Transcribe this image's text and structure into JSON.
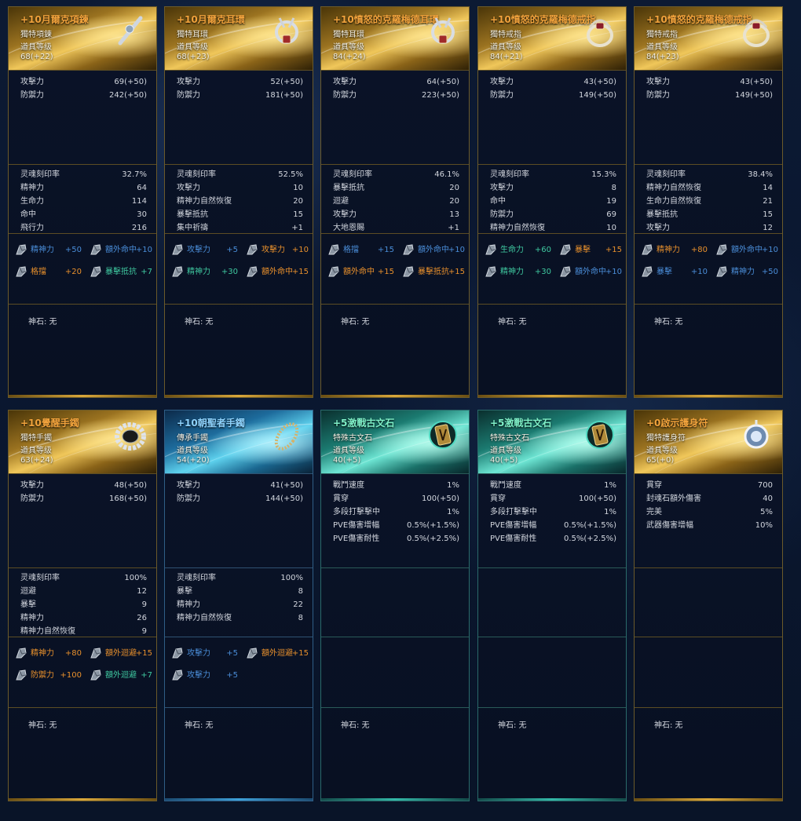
{
  "god_stone_label": "神石: 无",
  "cards": [
    {
      "theme": "gold",
      "title": "+10月爾克項鍊",
      "type": "獨特項鍊",
      "level_label": "道具等级",
      "level": "68(+22)",
      "icon": "necklace-icon",
      "base": [
        {
          "k": "攻擊力",
          "v": "69(+50)"
        },
        {
          "k": "防禦力",
          "v": "242(+50)"
        }
      ],
      "soul": [
        {
          "k": "灵魂刻印率",
          "v": "32.7%"
        },
        {
          "k": "精神力",
          "v": "64"
        },
        {
          "k": "生命力",
          "v": "114"
        },
        {
          "k": "命中",
          "v": "30"
        },
        {
          "k": "飛行力",
          "v": "216"
        }
      ],
      "stones": [
        {
          "name": "精神力",
          "val": "+50",
          "color": "blue"
        },
        {
          "name": "額外命中",
          "val": "+10",
          "color": "blue"
        },
        {
          "name": "格擋",
          "val": "+20",
          "color": "orange"
        },
        {
          "name": "暴擊抵抗",
          "val": "+7",
          "color": "green"
        }
      ]
    },
    {
      "theme": "gold",
      "title": "+10月爾克耳環",
      "type": "獨特耳環",
      "level_label": "道具等级",
      "level": "68(+23)",
      "icon": "earring-icon",
      "base": [
        {
          "k": "攻擊力",
          "v": "52(+50)"
        },
        {
          "k": "防禦力",
          "v": "181(+50)"
        }
      ],
      "soul": [
        {
          "k": "灵魂刻印率",
          "v": "52.5%"
        },
        {
          "k": "攻擊力",
          "v": "10"
        },
        {
          "k": "精神力自然恢復",
          "v": "20"
        },
        {
          "k": "暴擊抵抗",
          "v": "15"
        },
        {
          "k": "集中祈禱",
          "v": "+1"
        }
      ],
      "stones": [
        {
          "name": "攻擊力",
          "val": "+5",
          "color": "blue"
        },
        {
          "name": "攻擊力",
          "val": "+10",
          "color": "orange"
        },
        {
          "name": "精神力",
          "val": "+30",
          "color": "green"
        },
        {
          "name": "額外命中",
          "val": "+15",
          "color": "orange"
        }
      ]
    },
    {
      "theme": "gold",
      "title": "+10憤怒的克羅梅德耳環",
      "type": "獨特耳環",
      "level_label": "道具等级",
      "level": "84(+24)",
      "icon": "earring-icon",
      "base": [
        {
          "k": "攻擊力",
          "v": "64(+50)"
        },
        {
          "k": "防禦力",
          "v": "223(+50)"
        }
      ],
      "soul": [
        {
          "k": "灵魂刻印率",
          "v": "46.1%"
        },
        {
          "k": "暴擊抵抗",
          "v": "20"
        },
        {
          "k": "迴避",
          "v": "20"
        },
        {
          "k": "攻擊力",
          "v": "13"
        },
        {
          "k": "大地恩賜",
          "v": "+1"
        }
      ],
      "stones": [
        {
          "name": "格擋",
          "val": "+15",
          "color": "blue"
        },
        {
          "name": "額外命中",
          "val": "+10",
          "color": "blue"
        },
        {
          "name": "額外命中",
          "val": "+15",
          "color": "orange"
        },
        {
          "name": "暴擊抵抗",
          "val": "+15",
          "color": "orange"
        }
      ]
    },
    {
      "theme": "gold",
      "title": "+10憤怒的克羅梅德戒指",
      "type": "獨特戒指",
      "level_label": "道具等级",
      "level": "84(+21)",
      "icon": "ring-icon",
      "base": [
        {
          "k": "攻擊力",
          "v": "43(+50)"
        },
        {
          "k": "防禦力",
          "v": "149(+50)"
        }
      ],
      "soul": [
        {
          "k": "灵魂刻印率",
          "v": "15.3%"
        },
        {
          "k": "攻擊力",
          "v": "8"
        },
        {
          "k": "命中",
          "v": "19"
        },
        {
          "k": "防禦力",
          "v": "69"
        },
        {
          "k": "精神力自然恢復",
          "v": "10"
        }
      ],
      "stones": [
        {
          "name": "生命力",
          "val": "+60",
          "color": "green"
        },
        {
          "name": "暴擊",
          "val": "+15",
          "color": "orange"
        },
        {
          "name": "精神力",
          "val": "+30",
          "color": "green"
        },
        {
          "name": "額外命中",
          "val": "+10",
          "color": "blue"
        }
      ]
    },
    {
      "theme": "gold",
      "title": "+10憤怒的克羅梅德戒指",
      "type": "獨特戒指",
      "level_label": "道具等级",
      "level": "84(+23)",
      "icon": "ring-icon",
      "base": [
        {
          "k": "攻擊力",
          "v": "43(+50)"
        },
        {
          "k": "防禦力",
          "v": "149(+50)"
        }
      ],
      "soul": [
        {
          "k": "灵魂刻印率",
          "v": "38.4%"
        },
        {
          "k": "精神力自然恢復",
          "v": "14"
        },
        {
          "k": "生命力自然恢復",
          "v": "21"
        },
        {
          "k": "暴擊抵抗",
          "v": "15"
        },
        {
          "k": "攻擊力",
          "v": "12"
        }
      ],
      "stones": [
        {
          "name": "精神力",
          "val": "+80",
          "color": "orange"
        },
        {
          "name": "額外命中",
          "val": "+10",
          "color": "blue"
        },
        {
          "name": "暴擊",
          "val": "+10",
          "color": "blue"
        },
        {
          "name": "精神力",
          "val": "+50",
          "color": "blue"
        }
      ]
    },
    {
      "theme": "gold",
      "title": "+10覺醒手鐲",
      "type": "獨特手鐲",
      "level_label": "道具等级",
      "level": "63(+24)",
      "icon": "bracelet-icon",
      "base": [
        {
          "k": "攻擊力",
          "v": "48(+50)"
        },
        {
          "k": "防禦力",
          "v": "168(+50)"
        }
      ],
      "soul": [
        {
          "k": "灵魂刻印率",
          "v": "100%"
        },
        {
          "k": "迴避",
          "v": "12"
        },
        {
          "k": "暴擊",
          "v": "9"
        },
        {
          "k": "精神力",
          "v": "26"
        },
        {
          "k": "精神力自然恢復",
          "v": "9"
        }
      ],
      "stones": [
        {
          "name": "精神力",
          "val": "+80",
          "color": "orange"
        },
        {
          "name": "額外迴避",
          "val": "+15",
          "color": "orange"
        },
        {
          "name": "防禦力",
          "val": "+100",
          "color": "orange"
        },
        {
          "name": "額外迴避",
          "val": "+7",
          "color": "green"
        }
      ]
    },
    {
      "theme": "blue",
      "title": "+10朝聖者手鐲",
      "type": "傳承手鐲",
      "level_label": "道具等级",
      "level": "54(+20)",
      "icon": "bangle-icon",
      "base": [
        {
          "k": "攻擊力",
          "v": "41(+50)"
        },
        {
          "k": "防禦力",
          "v": "144(+50)"
        }
      ],
      "soul": [
        {
          "k": "灵魂刻印率",
          "v": "100%"
        },
        {
          "k": "暴擊",
          "v": "8"
        },
        {
          "k": "精神力",
          "v": "22"
        },
        {
          "k": "精神力自然恢復",
          "v": "8"
        }
      ],
      "stones": [
        {
          "name": "攻擊力",
          "val": "+5",
          "color": "blue"
        },
        {
          "name": "額外迴避",
          "val": "+15",
          "color": "orange"
        },
        {
          "name": "攻擊力",
          "val": "+5",
          "color": "blue"
        }
      ]
    },
    {
      "theme": "teal",
      "title": "+5激戰古文石",
      "type": "特殊古文石",
      "level_label": "道具等级",
      "level": "40(+5)",
      "icon": "rune-stone-icon",
      "base": [
        {
          "k": "戰鬥速度",
          "v": "1%"
        },
        {
          "k": "貫穿",
          "v": "100(+50)"
        },
        {
          "k": "多段打擊擊中",
          "v": "1%"
        },
        {
          "k": "PVE傷害增幅",
          "v": "0.5%(+1.5%)"
        },
        {
          "k": "PVE傷害耐性",
          "v": "0.5%(+2.5%)"
        }
      ],
      "soul": [],
      "stones": []
    },
    {
      "theme": "teal",
      "title": "+5激戰古文石",
      "type": "特殊古文石",
      "level_label": "道具等级",
      "level": "40(+5)",
      "icon": "rune-stone-icon",
      "base": [
        {
          "k": "戰鬥速度",
          "v": "1%"
        },
        {
          "k": "貫穿",
          "v": "100(+50)"
        },
        {
          "k": "多段打擊擊中",
          "v": "1%"
        },
        {
          "k": "PVE傷害增幅",
          "v": "0.5%(+1.5%)"
        },
        {
          "k": "PVE傷害耐性",
          "v": "0.5%(+2.5%)"
        }
      ],
      "soul": [],
      "stones": []
    },
    {
      "theme": "gold",
      "title": "+0啟示護身符",
      "type": "獨特護身符",
      "level_label": "道具等级",
      "level": "65(+0)",
      "icon": "amulet-icon",
      "base": [
        {
          "k": "貫穿",
          "v": "700"
        },
        {
          "k": "封魂石額外傷害",
          "v": "40"
        },
        {
          "k": "完美",
          "v": "5%"
        },
        {
          "k": "武器傷害增幅",
          "v": "10%"
        }
      ],
      "soul": [],
      "stones": []
    }
  ]
}
